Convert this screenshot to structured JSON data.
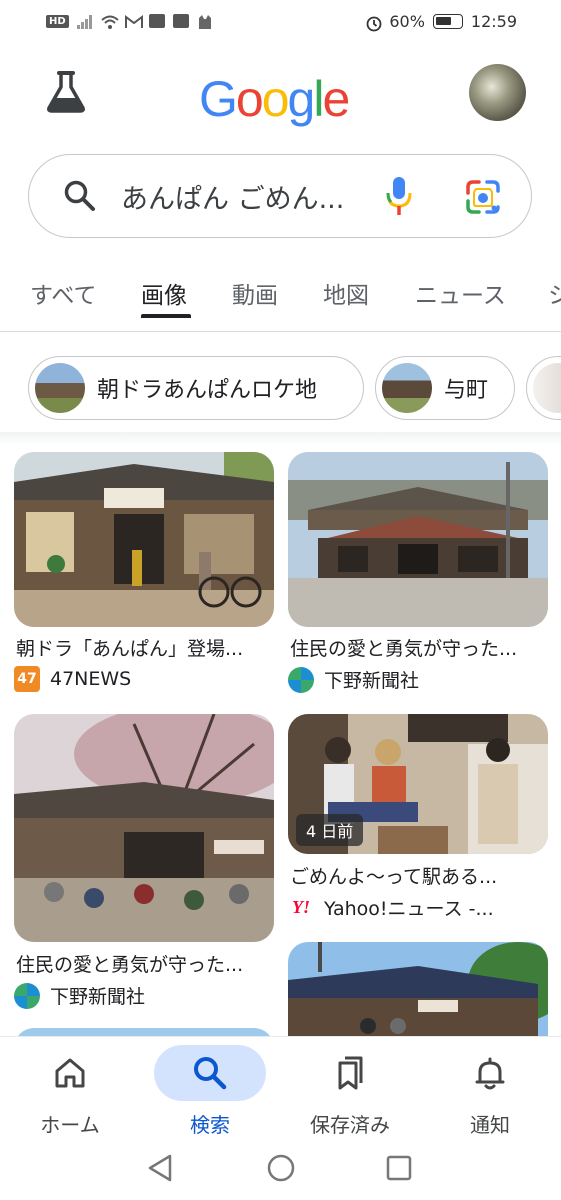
{
  "status_bar": {
    "badge": "HD",
    "battery": "60%",
    "time": "12:59"
  },
  "header": {
    "logo_letters": [
      "G",
      "o",
      "o",
      "g",
      "l",
      "e"
    ]
  },
  "search": {
    "query": "あんぱん ごめん..."
  },
  "tabs": [
    {
      "label": "すべて"
    },
    {
      "label": "画像"
    },
    {
      "label": "動画"
    },
    {
      "label": "地図"
    },
    {
      "label": "ニュース"
    }
  ],
  "active_tab": "画像",
  "chips": [
    {
      "label": "朝ドラあんぱんロケ地"
    },
    {
      "label": "与町"
    }
  ],
  "results": [
    {
      "title": "朝ドラ「あんぱん」登場...",
      "source": "47NEWS",
      "favicon": "47"
    },
    {
      "title": "住民の愛と勇気が守った...",
      "source": "下野新聞社",
      "favicon": "shimotsuke-icon"
    },
    {
      "title": "住民の愛と勇気が守った...",
      "source": "下野新聞社",
      "favicon": "shimotsuke-icon"
    },
    {
      "title": "ごめんよ～って駅ある...",
      "source": "Yahoo!ニュース -...",
      "favicon": "Y!",
      "badge": "4 日前"
    },
    {
      "title": "",
      "source": "",
      "favicon": ""
    }
  ],
  "bottom_nav": [
    {
      "label": "ホーム",
      "icon": "home-icon"
    },
    {
      "label": "検索",
      "icon": "search-icon"
    },
    {
      "label": "保存済み",
      "icon": "bookmarks-icon"
    },
    {
      "label": "通知",
      "icon": "bell-icon"
    }
  ],
  "colors": {
    "google_blue": "#4285F4",
    "google_red": "#EA4335",
    "google_yellow": "#FBBC05",
    "google_green": "#34A853",
    "active_nav": "#0b57d0",
    "active_nav_pill": "#d3e3fd"
  }
}
